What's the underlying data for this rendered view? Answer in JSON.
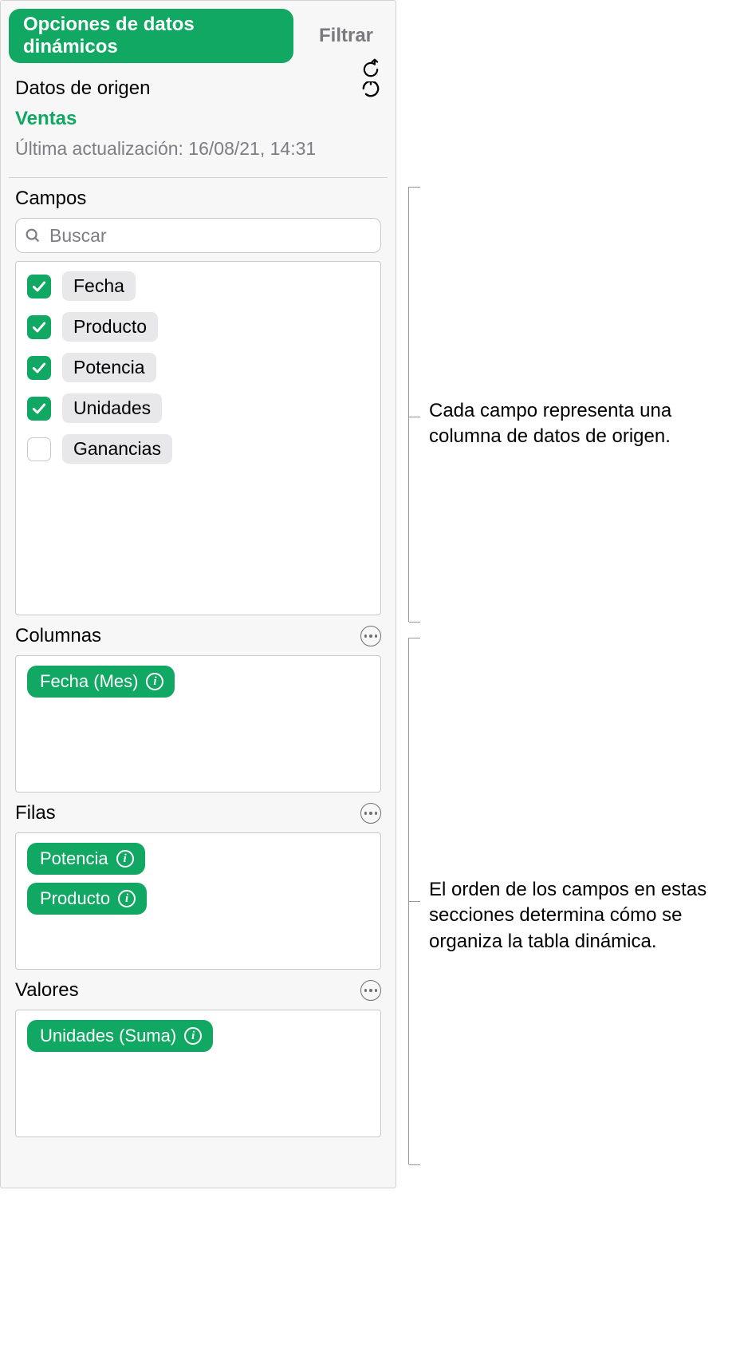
{
  "tabs": {
    "options": "Opciones de datos dinámicos",
    "filter": "Filtrar"
  },
  "source": {
    "label": "Datos de origen",
    "name": "Ventas",
    "updated": "Última actualización: 16/08/21, 14:31"
  },
  "fields": {
    "label": "Campos",
    "search_placeholder": "Buscar",
    "items": [
      {
        "label": "Fecha",
        "checked": true
      },
      {
        "label": "Producto",
        "checked": true
      },
      {
        "label": "Potencia",
        "checked": true
      },
      {
        "label": "Unidades",
        "checked": true
      },
      {
        "label": "Ganancias",
        "checked": false
      }
    ]
  },
  "columns": {
    "label": "Columnas",
    "items": [
      {
        "label": "Fecha (Mes)"
      }
    ]
  },
  "rows": {
    "label": "Filas",
    "items": [
      {
        "label": "Potencia"
      },
      {
        "label": "Producto"
      }
    ]
  },
  "values": {
    "label": "Valores",
    "items": [
      {
        "label": "Unidades (Suma)"
      }
    ]
  },
  "callouts": {
    "fields": "Cada campo representa una columna de datos de origen.",
    "order": "El orden de los campos en estas secciones determina cómo se organiza la tabla dinámica."
  }
}
